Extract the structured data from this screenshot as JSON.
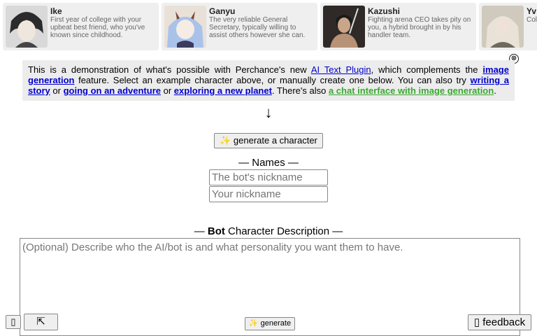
{
  "cards": [
    {
      "name": "Ike",
      "desc": "First year of college with your upbeat best friend, who you've known since childhood.",
      "color": "#6b6b6b"
    },
    {
      "name": "Ganyu",
      "desc": "The very reliable General Secretary, typically willing to assist others however she can.",
      "color": "#9fb7e0"
    },
    {
      "name": "Kazushi",
      "desc": "Fighting arena CEO takes pity on you, a hybrid brought in by his handler team.",
      "color": "#5a4a40"
    },
    {
      "name": "Yv",
      "desc": "Col ma und",
      "color": "#b9b3a3"
    }
  ],
  "banner": {
    "close_icon": "⊗",
    "t1": "This is a demonstration of what's possible with Perchance's new ",
    "link_plugin": "AI Text Plugin",
    "t2": ", which complements the ",
    "link_image": "image generation",
    "t3": " feature. Select an example character above, or manually create one below. You can also try ",
    "link_story": "writing a story",
    "t4": " or ",
    "link_adventure": "going on an adventure",
    "t5": " or ",
    "link_planet": "exploring a new planet",
    "t6": ". There's also ",
    "link_chat": "a chat interface with image generation",
    "t7": "."
  },
  "arrow": "↓",
  "generate_character_label": "✨ generate a character",
  "names": {
    "heading": "— Names —",
    "bot_placeholder": "The bot's nickname",
    "user_placeholder": "Your nickname"
  },
  "description": {
    "heading_prefix": "— ",
    "heading_bold": "Bot",
    "heading_suffix": " Character Description —",
    "placeholder": "(Optional) Describe who the AI/bot is and what personality you want them to have."
  },
  "bottom": {
    "left_icon": "▯",
    "expand_icon": "⇱",
    "generate_label": "✨ generate",
    "feedback_label": "▯ feedback"
  }
}
